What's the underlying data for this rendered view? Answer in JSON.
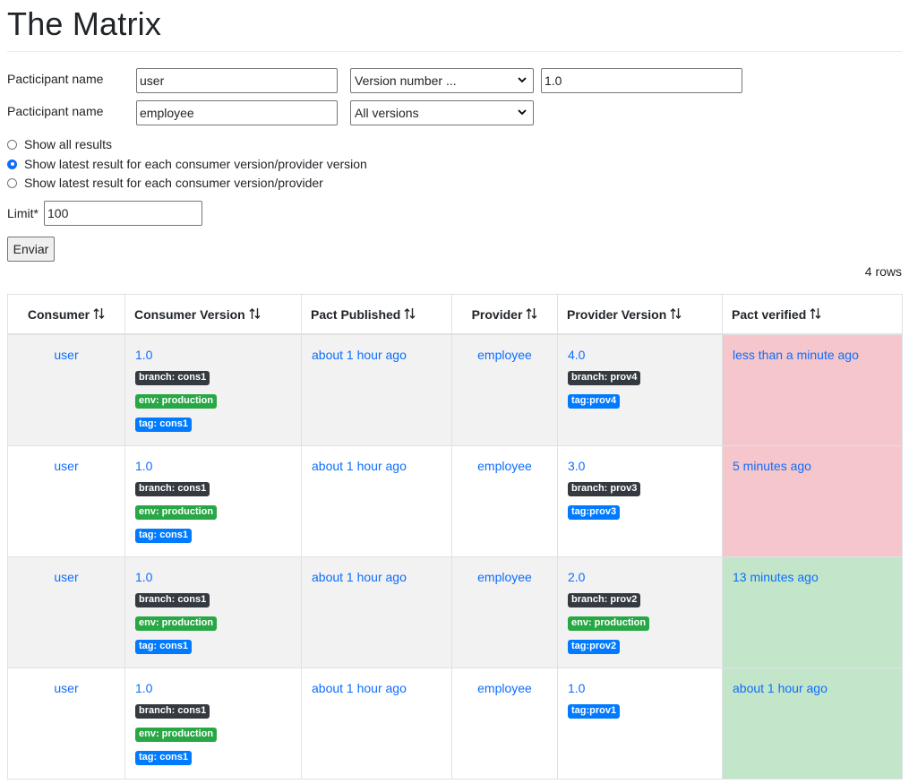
{
  "page": {
    "title": "The Matrix"
  },
  "form": {
    "selectors": [
      {
        "label": "Pacticipant name",
        "name_value": "user",
        "version_mode": "Version number ...",
        "version_value": "1.0"
      },
      {
        "label": "Pacticipant name",
        "name_value": "employee",
        "version_mode": "All versions"
      }
    ],
    "options": [
      {
        "label": "Show all results",
        "checked": false
      },
      {
        "label": "Show latest result for each consumer version/provider version",
        "checked": true
      },
      {
        "label": "Show latest result for each consumer version/provider",
        "checked": false
      }
    ],
    "limit_label": "Limit*",
    "limit_value": "100",
    "submit_label": "Enviar"
  },
  "row_count": "4 rows",
  "table": {
    "headers": [
      "Consumer",
      "Consumer Version",
      "Pact Published",
      "Provider",
      "Provider Version",
      "Pact verified"
    ],
    "rows": [
      {
        "consumer": "user",
        "consumer_version": "1.0",
        "consumer_branch": "branch: cons1",
        "consumer_env": "env: production",
        "consumer_tag": "tag: cons1",
        "pact_published": "about 1 hour ago",
        "provider": "employee",
        "provider_version": "4.0",
        "provider_branch": "branch: prov4",
        "provider_tag": "tag:prov4",
        "verified": "less than a minute ago",
        "status": "failed"
      },
      {
        "consumer": "user",
        "consumer_version": "1.0",
        "consumer_branch": "branch: cons1",
        "consumer_env": "env: production",
        "consumer_tag": "tag: cons1",
        "pact_published": "about 1 hour ago",
        "provider": "employee",
        "provider_version": "3.0",
        "provider_branch": "branch: prov3",
        "provider_tag": "tag:prov3",
        "verified": "5 minutes ago",
        "status": "failed"
      },
      {
        "consumer": "user",
        "consumer_version": "1.0",
        "consumer_branch": "branch: cons1",
        "consumer_env": "env: production",
        "consumer_tag": "tag: cons1",
        "pact_published": "about 1 hour ago",
        "provider": "employee",
        "provider_version": "2.0",
        "provider_branch": "branch: prov2",
        "provider_env": "env: production",
        "provider_tag": "tag:prov2",
        "verified": "13 minutes ago",
        "status": "success"
      },
      {
        "consumer": "user",
        "consumer_version": "1.0",
        "consumer_branch": "branch: cons1",
        "consumer_env": "env: production",
        "consumer_tag": "tag: cons1",
        "pact_published": "about 1 hour ago",
        "provider": "employee",
        "provider_version": "1.0",
        "provider_tag": "tag:prov1",
        "verified": "about 1 hour ago",
        "status": "success"
      }
    ]
  },
  "colors": {
    "link": "#0d6efd",
    "failed_bg": "#f5c6cb",
    "success_bg": "#c3e6cb",
    "badge_branch": "#343a40",
    "badge_env": "#28a745",
    "badge_tag": "#007bff"
  },
  "icons": {
    "sort": "sort-arrows-icon",
    "dropdown": "chevron-down-icon"
  }
}
